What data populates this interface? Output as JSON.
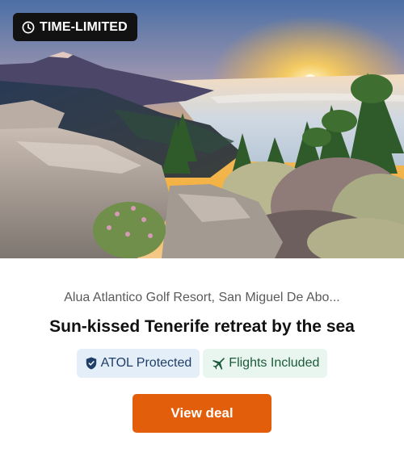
{
  "badge": {
    "label": "TIME-LIMITED",
    "icon": "clock-icon"
  },
  "hero": {
    "description_icon": "landscape-photo"
  },
  "location": "Alua Atlantico Golf Resort, San Miguel De Abo...",
  "headline": "Sun-kissed Tenerife retreat by the sea",
  "chips": [
    {
      "label": "ATOL Protected",
      "icon": "shield-icon",
      "color": "#1f3f68",
      "background": "#e3eef8"
    },
    {
      "label": "Flights Included",
      "icon": "airplane-icon",
      "color": "#1c5a3a",
      "background": "#e8f6ef"
    }
  ],
  "cta": {
    "label": "View deal",
    "color": "#e35e0a"
  }
}
